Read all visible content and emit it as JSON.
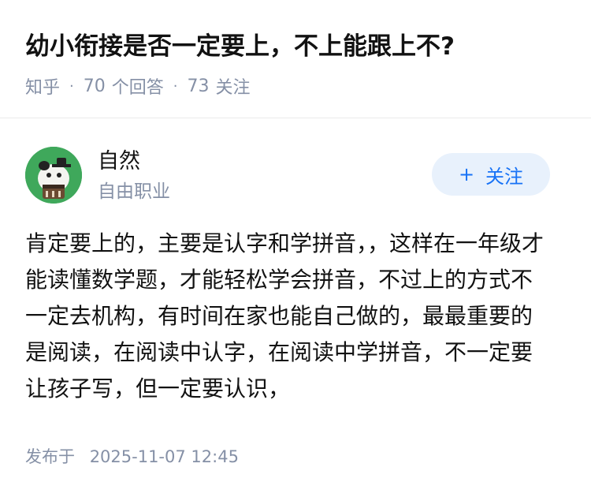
{
  "question": {
    "title": "幼小衔接是否一定要上，不上能跟上不?",
    "source": "知乎",
    "answer_count": "70",
    "answer_label": "个回答",
    "follower_count": "73",
    "follower_label": "关注"
  },
  "author": {
    "name": "自然",
    "headline": "自由职业",
    "follow_label": "关注",
    "follow_icon": "plus-icon"
  },
  "answer": {
    "content": "肯定要上的，主要是认字和学拼音，，这样在一年级才能读懂数学题，才能轻松学会拼音，不过上的方式不一定去机构，有时间在家也能自己做的，最最重要的是阅读，在阅读中认字，在阅读中学拼音，不一定要让孩子写，但一定要认识，",
    "publish_label": "发布于",
    "publish_time": "2025-11-07 12:45"
  },
  "colors": {
    "text": "#121212",
    "meta": "#8590a6",
    "accent": "#1772f6",
    "follow_bg": "#e8f1fc",
    "avatar_bg": "#3fa85b"
  }
}
